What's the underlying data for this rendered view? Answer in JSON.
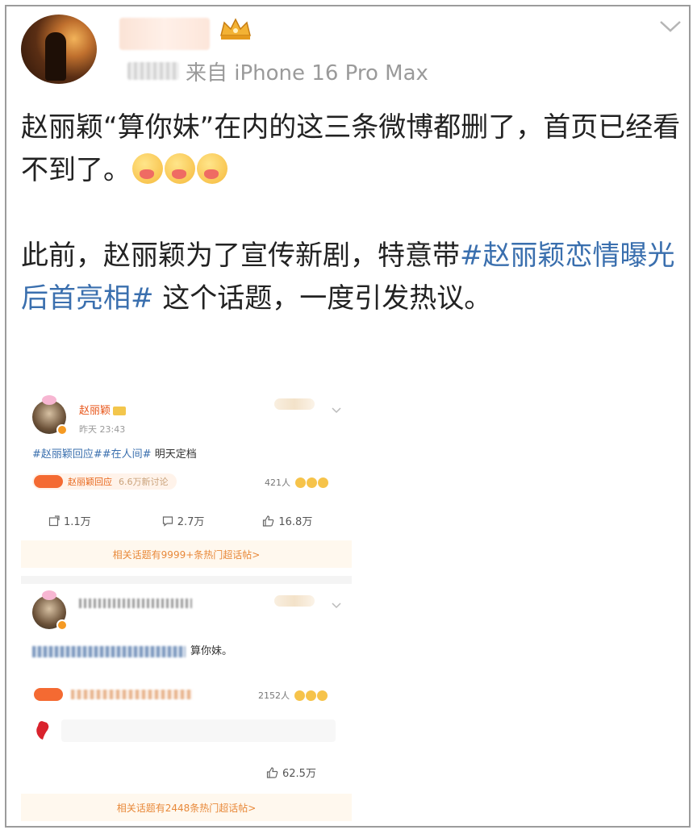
{
  "post": {
    "source": "来自 iPhone 16 Pro Max",
    "paragraph1_text": "赵丽颖“算你妹”在内的这三条微博都删了，首页已经看不到了。",
    "paragraph2_prefix": "此前，赵丽颖为了宣传新剧，特意带",
    "paragraph2_tag": "#赵丽颖恋情曝光后首亮相#",
    "paragraph2_suffix": " 这个话题，一度引发热议。",
    "emoji_count": 3
  },
  "embedded": {
    "card1": {
      "username": "赵丽颖",
      "time": "昨天 23:43",
      "text_tags": "#赵丽颖回应##在人间#",
      "text_body": " 明天定档",
      "topic_label": "赵丽颖回应",
      "topic_sub": "6.6万新讨论",
      "people": "421人",
      "repost": "1.1万",
      "comment": "2.7万",
      "like": "16.8万",
      "related": "相关话题有9999+条热门超话帖>"
    },
    "card2": {
      "text_body": "算你妹。",
      "people": "2152人",
      "like": "62.5万",
      "related": "相关话题有2448条热门超话帖>"
    }
  },
  "icons": [
    "crown-icon",
    "chevron-down-icon",
    "repost-icon",
    "comment-icon",
    "like-icon",
    "map-icon"
  ],
  "colors": {
    "tag_blue": "#3a6fae",
    "accent_orange": "#e8561a"
  }
}
